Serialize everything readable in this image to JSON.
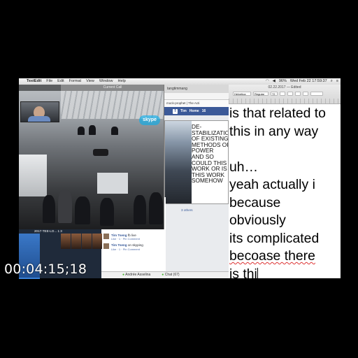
{
  "menubar": {
    "app": "TextEdit",
    "items": [
      "File",
      "Edit",
      "Format",
      "View",
      "Window",
      "Help"
    ],
    "battery": "96%",
    "clock": "Wed Feb 22  17:59:37"
  },
  "skype": {
    "title": "Current Call",
    "logo": "skype",
    "bottom_caption": "2017-TEE-LO... 1 3"
  },
  "browser": {
    "tab_title": "tangtimmang",
    "bookmark_text": "mock-prophet | The Acti",
    "fb_user": "Tim",
    "fb_home": "Home",
    "fb_home_count": "16",
    "shares": "3 others"
  },
  "inner_text": [
    "DE-",
    "STABILIZATIO",
    "OF EXISTING",
    "METHODS OF",
    "POWER",
    "AND SO",
    "COULD THIS",
    "WORK OR IS",
    "THIS WORK",
    "SOMEHOW"
  ],
  "feed": {
    "comments": [
      {
        "author": "Tim Tseng",
        "text": "",
        "like": "Like",
        "count": "1",
        "action": "Pin Comment"
      },
      {
        "author": "Tim Tseng",
        "text": "screenrecording",
        "like": "Like",
        "count": "1",
        "action": "Pin Comment"
      },
      {
        "author": "Tim Tseng",
        "text": "fb live",
        "like": "Like",
        "count": "1",
        "action": "Pin Comment"
      },
      {
        "author": "Tim Tseng",
        "text": "on skyping",
        "like": "Like",
        "count": "1",
        "action": "Pin Comment"
      }
    ],
    "chat_name": "Andrée Asselina",
    "chat_label": "Chat (67)"
  },
  "textedit": {
    "doc_title": "02.22.2017 — Edited",
    "font_name": "Helvetica",
    "font_style": "Regular",
    "font_size": "72",
    "lines": [
      "is that related to",
      "this in any way",
      "",
      "uh…",
      "yeah actually i",
      "because",
      "obviously",
      "its complicated",
      "becoase there",
      "is thi"
    ]
  },
  "timecode": "00:04:15;18"
}
